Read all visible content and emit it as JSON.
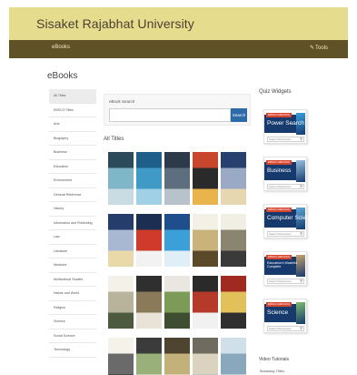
{
  "header": {
    "site_title": "Sisaket Rajabhat University",
    "nav_item": "eBooks",
    "nav_tools_label": "Tools",
    "nav_tools_icon": "wrench-icon"
  },
  "page": {
    "heading": "eBooks"
  },
  "sidebar": {
    "items": [
      {
        "label": "All Titles",
        "active": true
      },
      {
        "label": "EBSCO Titles",
        "active": false
      },
      {
        "label": "Arts",
        "active": false
      },
      {
        "label": "Biography",
        "active": false
      },
      {
        "label": "Business",
        "active": false
      },
      {
        "label": "Education",
        "active": false
      },
      {
        "label": "Environment",
        "active": false
      },
      {
        "label": "General Reference",
        "active": false
      },
      {
        "label": "History",
        "active": false
      },
      {
        "label": "Information and Publishing",
        "active": false
      },
      {
        "label": "Law",
        "active": false
      },
      {
        "label": "Literature",
        "active": false
      },
      {
        "label": "Medicine",
        "active": false
      },
      {
        "label": "Multicultural Studies",
        "active": false
      },
      {
        "label": "Nature and World",
        "active": false
      },
      {
        "label": "Religion",
        "active": false
      },
      {
        "label": "Science",
        "active": false
      },
      {
        "label": "Social Science",
        "active": false
      },
      {
        "label": "Technology",
        "active": false
      }
    ]
  },
  "search": {
    "label": "eBook Search",
    "placeholder": "",
    "value": "",
    "button_label": "Search"
  },
  "all_titles": {
    "heading": "All Titles",
    "books": [
      {
        "colors": [
          "#2b4a5a",
          "#7fb7c8",
          "#c9dbe3"
        ]
      },
      {
        "colors": [
          "#1d5f8a",
          "#3f9bc6",
          "#9fd0e6"
        ]
      },
      {
        "colors": [
          "#2c3a4a",
          "#5d6f7e",
          "#b7c2ca"
        ]
      },
      {
        "colors": [
          "#c8462b",
          "#2a2a2a",
          "#e9b44c"
        ]
      },
      {
        "colors": [
          "#28406e",
          "#9aa9c4",
          "#e7d7b0"
        ]
      },
      {
        "colors": [
          "#253d6b",
          "#a9b8d2",
          "#e9d9a8"
        ]
      },
      {
        "colors": [
          "#1c2f52",
          "#d03a2b",
          "#f2f2f2"
        ]
      },
      {
        "colors": [
          "#1e4f8c",
          "#3ba0d8",
          "#e0eef7"
        ]
      },
      {
        "colors": [
          "#f3f0e6",
          "#c9b37a",
          "#5b4a2a"
        ]
      },
      {
        "colors": [
          "#f1eee4",
          "#8b8570",
          "#3a3a3a"
        ]
      },
      {
        "colors": [
          "#f4f1e8",
          "#b9b39c",
          "#4e5a3e"
        ]
      },
      {
        "colors": [
          "#2f2f2f",
          "#8a7a5a",
          "#e8e3d6"
        ]
      },
      {
        "colors": [
          "#e9e7e0",
          "#7c9b56",
          "#3e4e30"
        ]
      },
      {
        "colors": [
          "#2a2a2a",
          "#b53a2a",
          "#f1f1f1"
        ]
      },
      {
        "colors": [
          "#a12a20",
          "#e2c05a",
          "#2f2f2f"
        ]
      },
      {
        "colors": [
          "#f5f2ea",
          "#6a6a6a",
          "#2a2a2a"
        ]
      },
      {
        "colors": [
          "#3b3b3b",
          "#9ab07a",
          "#e7ebd9"
        ]
      },
      {
        "colors": [
          "#4e4430",
          "#c2b27a",
          "#f1ecd8"
        ]
      },
      {
        "colors": [
          "#6f6b5e",
          "#d9d3c0",
          "#a3b8c8"
        ]
      },
      {
        "colors": [
          "#cfe0ea",
          "#8aa8bc",
          "#f5f5f5"
        ]
      }
    ]
  },
  "widgets": {
    "heading": "Quiz Widgets",
    "items": [
      {
        "tag": "EBSCO EBOOKS",
        "title": "Power Search",
        "small": false,
        "search_placeholder": "Search Resources",
        "accent": "#3aa0e0"
      },
      {
        "tag": "EBSCO EBOOKS",
        "title": "Business",
        "small": false,
        "search_placeholder": "Search Resources",
        "accent": "#9bc1e0"
      },
      {
        "tag": "EBSCO EBOOKS",
        "title": "Computer Science",
        "small": false,
        "search_placeholder": "Search Resources",
        "accent": "#5fa8d8"
      },
      {
        "tag": "EBSCO EBOOKS",
        "title": "Education's Wasteful Complete",
        "small": true,
        "search_placeholder": "Search Resources",
        "accent": "#c7a36b"
      },
      {
        "tag": "EBSCO EBOOKS",
        "title": "Science",
        "small": false,
        "search_placeholder": "Search Resources",
        "accent": "#7dbd6a"
      }
    ]
  },
  "video": {
    "heading": "Video Tutorials",
    "link": "Browsing Titles"
  },
  "colors": {
    "header_band": "#e6dc8e",
    "nav_bar": "#5e5226",
    "search_button": "#2d6aa8",
    "widget_band": "#163a6e",
    "widget_tag": "#d8452e"
  }
}
